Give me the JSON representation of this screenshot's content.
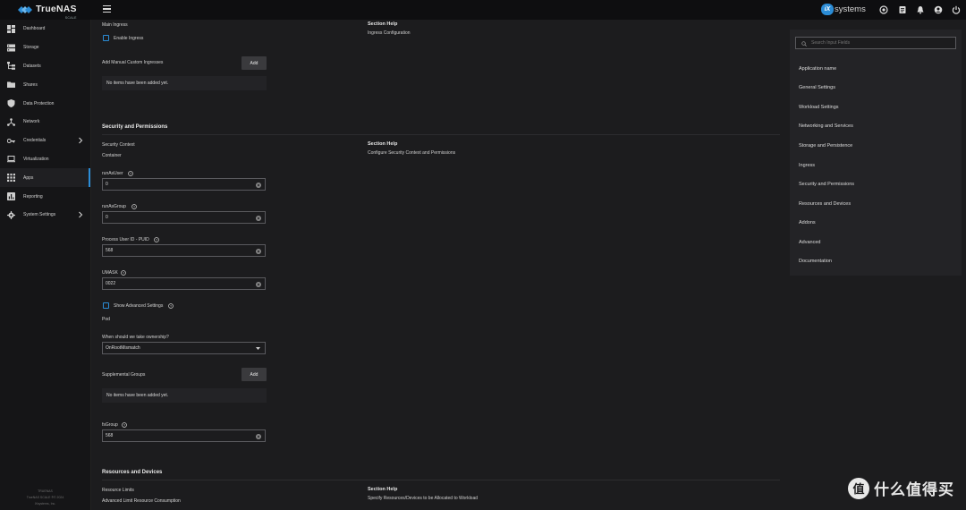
{
  "app": {
    "name": "TrueNAS",
    "sub": "SCALE"
  },
  "vendor": {
    "badge": "iX",
    "name": "systems"
  },
  "colors": {
    "accent": "#2b8cd6",
    "background": "#1c1c1e",
    "sidebar": "#151517",
    "topbar": "#0e0e10"
  },
  "sidebar": {
    "items": [
      {
        "label": "Dashboard",
        "icon": "dashboard-icon"
      },
      {
        "label": "Storage",
        "icon": "storage-icon"
      },
      {
        "label": "Datasets",
        "icon": "datasets-icon"
      },
      {
        "label": "Shares",
        "icon": "folder-icon"
      },
      {
        "label": "Data Protection",
        "icon": "shield-icon"
      },
      {
        "label": "Network",
        "icon": "network-icon"
      },
      {
        "label": "Credentials",
        "icon": "key-icon"
      },
      {
        "label": "Virtualization",
        "icon": "laptop-icon"
      },
      {
        "label": "Apps",
        "icon": "apps-icon"
      },
      {
        "label": "Reporting",
        "icon": "chart-icon"
      },
      {
        "label": "System Settings",
        "icon": "gear-icon"
      }
    ],
    "footer": [
      "TRUENAS",
      "TrueNAS SCALE ®© 2024",
      "iXsystems, Inc."
    ]
  },
  "ingress": {
    "main_label": "Main Ingress",
    "enable_label": "Enable Ingress",
    "custom_label": "Add Manual Custom Ingresses",
    "add_label": "Add",
    "empty_text": "No items have been added yet.",
    "help_title": "Section Help",
    "help_text": "Ingress Configuration"
  },
  "security": {
    "title": "Security and Permissions",
    "context_label": "Security Context",
    "container_label": "Container",
    "help_title": "Section Help",
    "help_text": "Configure Security Context and Permissions",
    "run_as_user_label": "runAsUser",
    "run_as_user_value": "0",
    "run_as_group_label": "runAsGroup",
    "run_as_group_value": "0",
    "puid_label": "Process User ID - PUID",
    "puid_value": "568",
    "umask_label": "UMASK",
    "umask_value": "0022",
    "advanced_label": "Show Advanced Settings",
    "pod_label": "Pod",
    "ownership_label": "When should we take ownership?",
    "ownership_value": "OnRootMismatch",
    "supplemental_label": "Supplemental Groups",
    "add_label": "Add",
    "empty_text": "No items have been added yet.",
    "fsgroup_label": "fsGroup",
    "fsgroup_value": "568"
  },
  "resources": {
    "title": "Resources and Devices",
    "limits_label": "Resource Limits",
    "advanced_label": "Advanced Limit Resource Consumption",
    "help_title": "Section Help",
    "help_text": "Specify Resources/Devices to be Allocated to Workload"
  },
  "right_panel": {
    "search_placeholder": "Search Input Fields",
    "items": [
      "Application name",
      "General Settings",
      "Workload Settings",
      "Networking and Services",
      "Storage and Persistence",
      "Ingress",
      "Security and Permissions",
      "Resources and Devices",
      "Addons",
      "Advanced",
      "Documentation"
    ]
  },
  "watermark": {
    "badge": "值",
    "text": "什么值得买"
  }
}
